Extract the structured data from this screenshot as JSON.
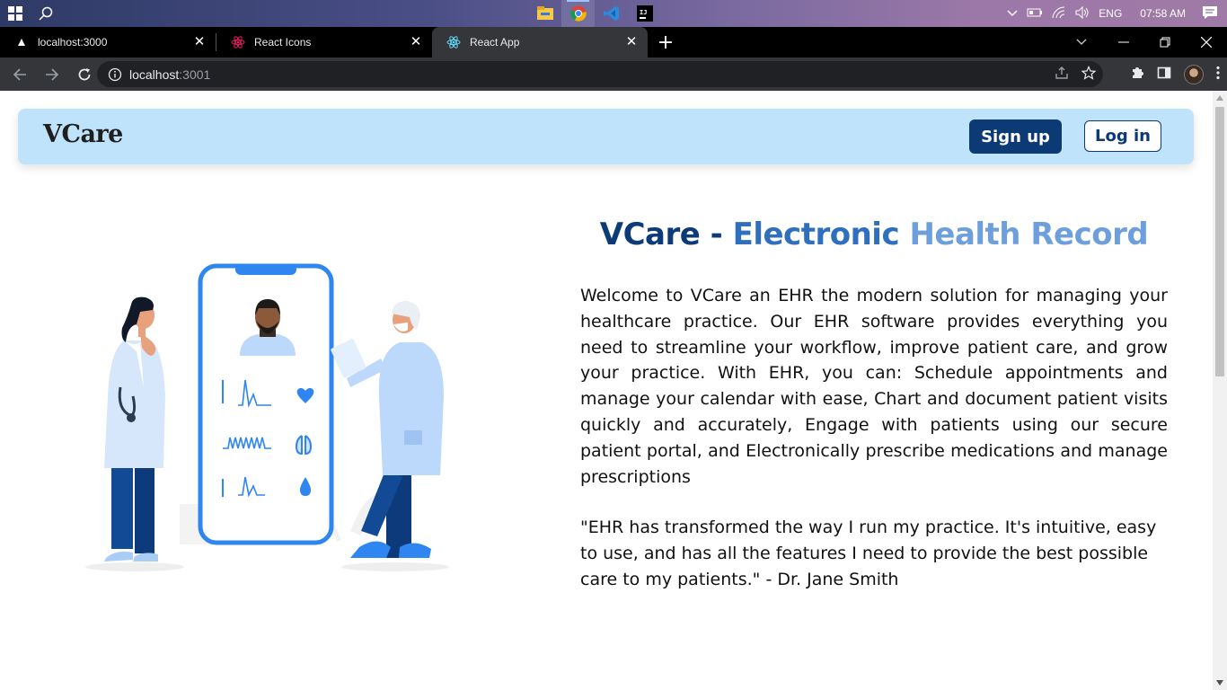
{
  "taskbar": {
    "language": "ENG",
    "time": "07:58 AM",
    "apps": [
      "file-explorer",
      "chrome",
      "vscode",
      "intellij"
    ]
  },
  "browser": {
    "tabs": [
      {
        "title": "localhost:3000",
        "icon": "triangle-icon",
        "active": false
      },
      {
        "title": "React Icons",
        "icon": "react-icons-icon",
        "active": false
      },
      {
        "title": "React App",
        "icon": "react-icon",
        "active": true
      }
    ],
    "url_host": "localhost",
    "url_port": ":3001"
  },
  "navbar": {
    "brand": "VCare",
    "signup_label": "Sign up",
    "login_label": "Log in"
  },
  "hero": {
    "title_part1": "VCare - ",
    "title_part2": "Electronic ",
    "title_part3": "Health Record",
    "description": "Welcome to VCare an EHR the modern solution for managing your healthcare practice. Our EHR software provides everything you need to streamline your workflow, improve patient care, and grow your practice. With EHR, you can: Schedule appointments and manage your calendar with ease, Chart and document patient visits quickly and accurately, Engage with patients using our secure patient portal, and Electronically prescribe medications and manage prescriptions",
    "quote": "\"EHR has transformed the way I run my practice. It's intuitive, easy to use, and has all the features I need to provide the best possible care to my patients.\" - Dr. Jane Smith"
  },
  "colors": {
    "navbar_bg": "#bfe3fb",
    "primary": "#0b3a74",
    "title_mid": "#2f6fbd",
    "title_light": "#6d9fdc",
    "illustration_blue": "#2f86f0"
  }
}
